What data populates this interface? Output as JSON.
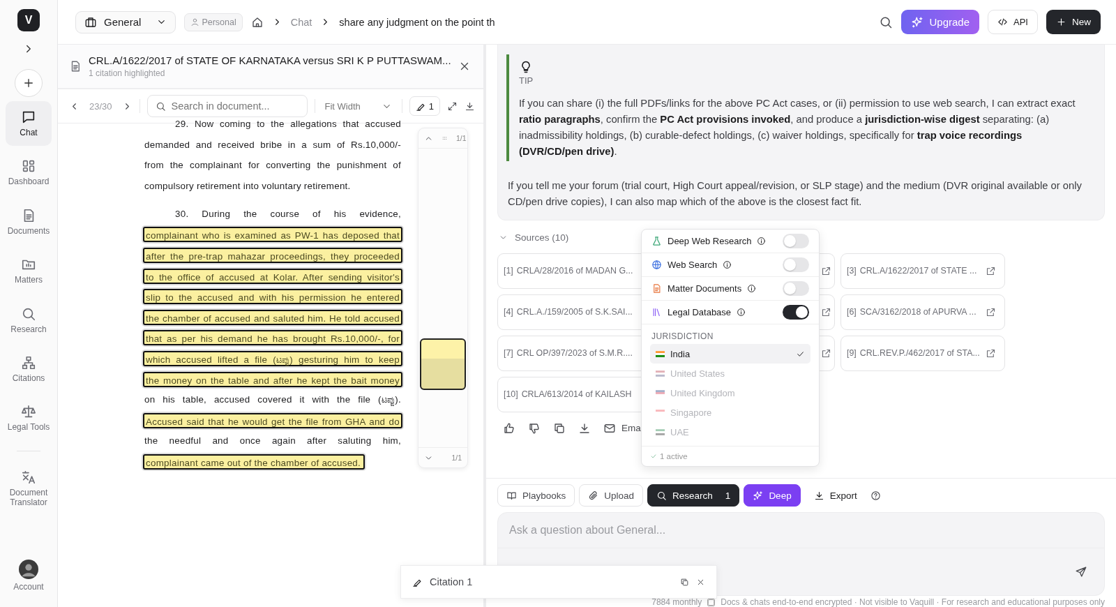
{
  "sidebar": {
    "logo": "V",
    "items": [
      {
        "label": "Chat",
        "selected": true
      },
      {
        "label": "Dashboard",
        "selected": false
      },
      {
        "label": "Documents",
        "selected": false
      },
      {
        "label": "Matters",
        "selected": false
      },
      {
        "label": "Research",
        "selected": false
      },
      {
        "label": "Citations",
        "selected": false
      },
      {
        "label": "Legal Tools",
        "selected": false
      },
      {
        "label": "Document Translator",
        "selected": false
      }
    ],
    "account": "Account"
  },
  "topbar": {
    "workspace": "General",
    "badge": "Personal",
    "breadcrumb": [
      "Chat",
      "share any judgment on the point th"
    ],
    "buttons": [
      "Upgrade",
      "API",
      "New"
    ]
  },
  "document": {
    "title": "CRL.A/1622/2017 of STATE OF KARNATAKA versus SRI K P PUTTASWAM...",
    "subtitle": "1 citation highlighted",
    "page": "23/30",
    "search": {
      "placeholder": "Search in document..."
    },
    "zoom": "Fit Width",
    "citation_count": "1",
    "paragraphs": [
      {
        "lines": [
          {
            "text": "29. Now coming to the allegations that accused",
            "highlighted": false
          },
          {
            "text": "demanded and received bribe in a sum of Rs.10,000/-",
            "highlighted": false
          },
          {
            "text": "from the complainant for converting the punishment of",
            "highlighted": false
          },
          {
            "text": "compulsory retirement into voluntary retirement.",
            "highlighted": false
          }
        ]
      },
      {
        "lines": [
          {
            "text": "30. During the course of his evidence,",
            "highlighted": false
          },
          {
            "text": "complainant who is examined as PW-1 has deposed that",
            "highlighted": true
          },
          {
            "text": "after the pre-trap mahazar proceedings, they proceeded",
            "highlighted": true
          },
          {
            "text": "to the office of accused at Kolar. After sending visitor's",
            "highlighted": true
          },
          {
            "text": "slip to the accused and with his permission he entered",
            "highlighted": true
          },
          {
            "text": "the chamber of accused and saluted him. He told accused",
            "highlighted": true
          },
          {
            "text": "that as per his demand he has brought Rs.10,000/-, for",
            "highlighted": true
          },
          {
            "text": "which accused lifted a file (ಟಪ್ಪು) gesturing him to keep",
            "highlighted": true
          },
          {
            "text": "the money on the table and after he kept the bait money",
            "highlighted": true
          },
          {
            "text": "on his table, accused covered it with the file (ಟಪ್ಪು).",
            "highlighted": false
          },
          {
            "text": "Accused said that he would get the file from GHA and do",
            "highlighted": true
          },
          {
            "text": "the needful and once again after saluting him,",
            "highlighted": false
          },
          {
            "text": "complainant came out of the chamber of accused.",
            "highlighted": true
          }
        ]
      }
    ],
    "thumbnails": {
      "top_count": "1/1",
      "bottom_count": "1/1"
    }
  },
  "tip": {
    "label": "TIP",
    "text": "If you can share (i) the full PDFs/links for the above PC Act cases, or (ii) permission to use web search, I can extract exact **ratio paragraphs**, confirm the **PC Act provisions invoked**, and produce a **jurisdiction-wise digest** separating: (a) inadmissibility holdings, (b) curable-defect holdings, (c) waiver holdings, specifically for **trap voice recordings (DVR/CD/pen drive)**.",
    "followup": "If you tell me your forum (trial court, High Court appeal/revision, or SLP stage) and the medium (DVR original available or only CD/pen drive copies), I can also map which of the above is the closest fact fit."
  },
  "sources": {
    "label": "Sources (10)",
    "expanded": true,
    "items": [
      {
        "kind": "card",
        "ref": "[1]",
        "title": "CRLA/28/2016 of MADAN G..."
      },
      {
        "kind": "covered"
      },
      {
        "kind": "card",
        "ref": "[3]",
        "title": "CRL.A/1622/2017 of STATE ..."
      },
      {
        "kind": "card",
        "ref": "[4]",
        "title": "CRL.A./159/2005 of S.K.SAI..."
      },
      {
        "kind": "covered"
      },
      {
        "kind": "card",
        "ref": "[6]",
        "title": "SCA/3162/2018 of APURVA ..."
      },
      {
        "kind": "card",
        "ref": "[7]",
        "title": "CRL OP/397/2023 of S.M.R...."
      },
      {
        "kind": "covered"
      },
      {
        "kind": "card",
        "ref": "[9]",
        "title": "CRL.REV.P./462/2017 of STA..."
      },
      {
        "kind": "card",
        "ref": "[10]",
        "title": "CRLA/613/2014 of KAILASH"
      }
    ]
  },
  "actions": {
    "email": "Ema"
  },
  "research_menu": {
    "toggles": [
      {
        "label": "Deep Web Research",
        "on": false
      },
      {
        "label": "Web Search",
        "on": false
      },
      {
        "label": "Matter Documents",
        "on": false
      },
      {
        "label": "Legal Database",
        "on": true
      }
    ],
    "heading": "JURISDICTION",
    "countries": [
      {
        "label": "India",
        "selected": true,
        "disabled": false
      },
      {
        "label": "United States",
        "selected": false,
        "disabled": true
      },
      {
        "label": "United Kingdom",
        "selected": false,
        "disabled": true
      },
      {
        "label": "Singapore",
        "selected": false,
        "disabled": true
      },
      {
        "label": "UAE",
        "selected": false,
        "disabled": true
      }
    ],
    "footer": "1 active"
  },
  "composer": {
    "tools": [
      {
        "kind": "plain",
        "label": "Playbooks"
      },
      {
        "kind": "plain",
        "label": "Upload"
      },
      {
        "kind": "research",
        "label": "Research",
        "count": "1",
        "selected": true
      },
      {
        "kind": "deep",
        "label": "Deep",
        "selected": true
      },
      {
        "kind": "bare",
        "label": "Export"
      }
    ],
    "placeholder": "Ask a question about General...",
    "footer_usage": "7884 monthly",
    "footer_note": "Docs & chats end-to-end encrypted · Not visible to Vaquill · For research and educational purposes only"
  },
  "citation_popup": {
    "label": "Citation 1"
  }
}
